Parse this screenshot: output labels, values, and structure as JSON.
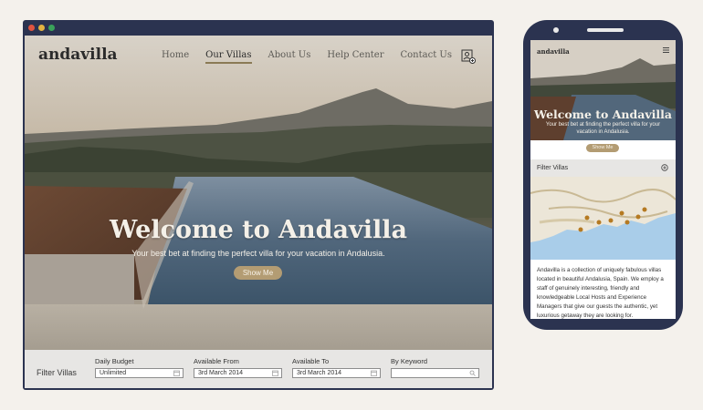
{
  "desktop": {
    "logo": "andavilla",
    "nav": [
      "Home",
      "Our Villas",
      "About Us",
      "Help Center",
      "Contact Us"
    ],
    "active_nav": "Our Villas",
    "hero": {
      "title": "Welcome to Andavilla",
      "subtitle": "Your best bet at finding the perfect villa for your vacation in Andalusia.",
      "button": "Show Me"
    },
    "filter": {
      "title": "Filter Villas",
      "fields": [
        {
          "label": "Daily Budget",
          "value": "Unlimited",
          "icon": "calendar-icon"
        },
        {
          "label": "Available From",
          "value": "3rd March 2014",
          "icon": "calendar-icon"
        },
        {
          "label": "Available To",
          "value": "3rd March 2014",
          "icon": "calendar-icon"
        },
        {
          "label": "By Keyword",
          "value": "",
          "icon": "search-icon"
        }
      ]
    },
    "colors": {
      "frame": "#2b3350",
      "accent": "#b39c73",
      "dot_red": "#e0543f",
      "dot_yellow": "#e3b341",
      "dot_green": "#3aa35a"
    }
  },
  "mobile": {
    "logo": "andavilla",
    "hero": {
      "title": "Welcome to Andavilla",
      "subtitle": "Your best bet at finding the perfect villa for your vacation in Andalusia.",
      "button": "Show Me"
    },
    "filter_title": "Filter Villas",
    "about_text": "Andavilla is a collection of uniquely fabulous villas located in beautiful Andalusia, Spain. We employ a staff of genuinely interesting, friendly and knowledgeable Local Hosts and Experience Managers that give our guests the authentic, yet luxurious getaway they are looking for."
  }
}
